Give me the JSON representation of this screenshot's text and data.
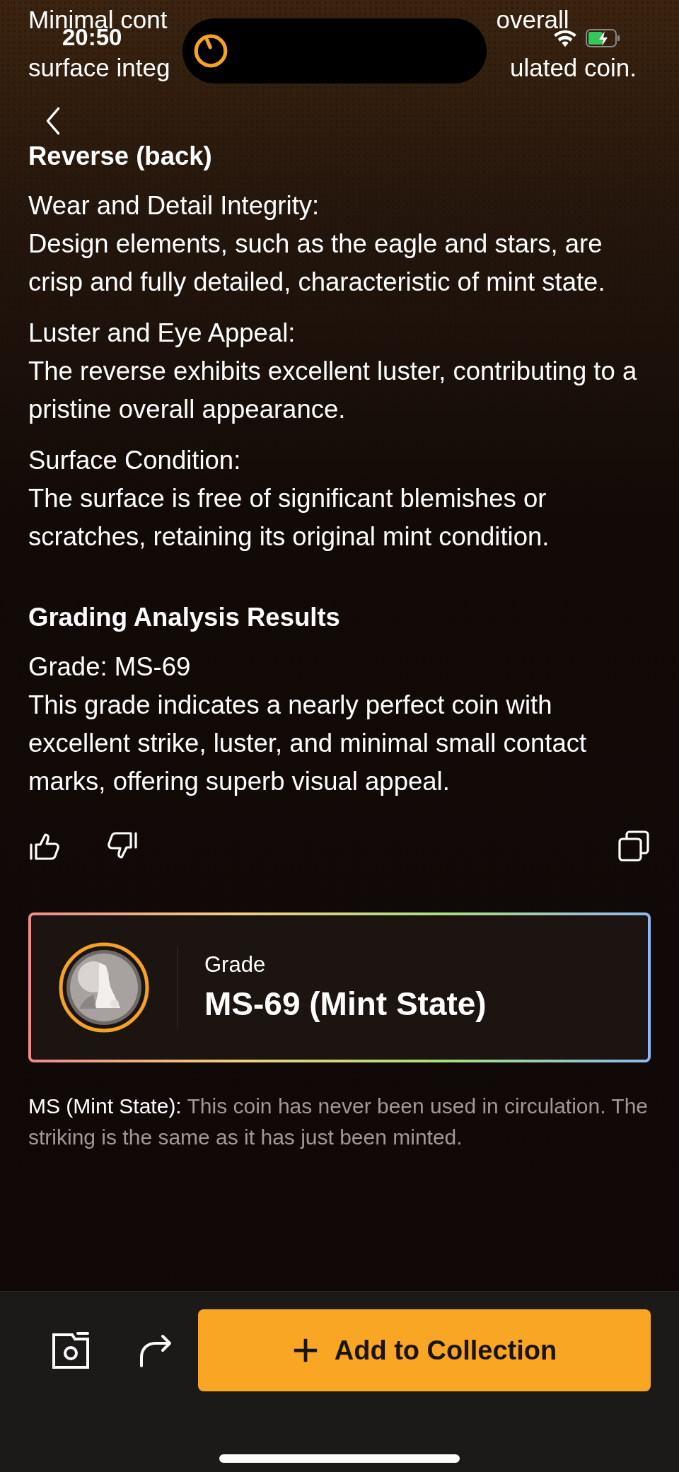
{
  "status_bar": {
    "time": "20:50"
  },
  "intro": {
    "line_1_start": "Minimal cont",
    "line_1_end": "overall",
    "line_2_start": "surface integ",
    "line_2_end": "ulated coin."
  },
  "sections": [
    {
      "title": "Reverse (back)",
      "items": [
        {
          "label": "Wear and Detail Integrity:",
          "text": "Design elements, such as the eagle and stars, are crisp and fully detailed, characteristic of mint state."
        },
        {
          "label": "Luster and Eye Appeal:",
          "text": "The reverse exhibits excellent luster, contributing to a pristine overall appearance."
        },
        {
          "label": "Surface Condition:",
          "text": "The surface is free of significant blemishes or scratches, retaining its original mint condition."
        }
      ]
    },
    {
      "title": "Grading Analysis Results",
      "items": [
        {
          "label": "Grade: MS-69",
          "text": "This grade indicates a nearly perfect coin with excellent strike, luster, and minimal small contact marks, offering superb visual appeal."
        }
      ]
    }
  ],
  "grade_card": {
    "label": "Grade",
    "value": "MS-69 (Mint State)"
  },
  "note": {
    "term": "MS (Mint State):",
    "text": "This coin has never been used in circulation. The striking is the same as it has just been minted."
  },
  "bottom_bar": {
    "add_button": "Add to Collection"
  }
}
